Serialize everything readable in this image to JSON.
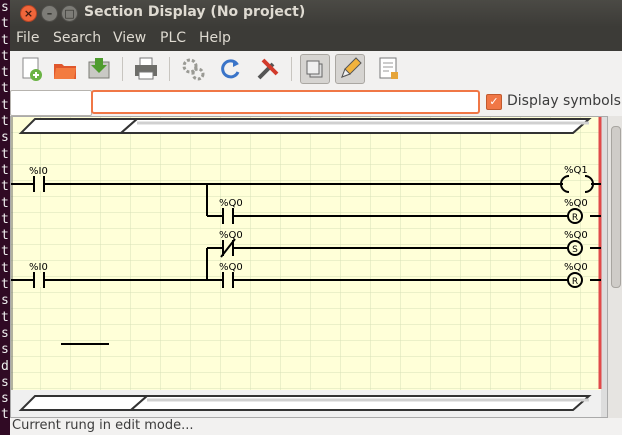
{
  "terminal_chars": [
    "s",
    "t",
    "t",
    "t",
    "t",
    "t",
    "t",
    "t",
    "s",
    "t",
    "t",
    "t",
    "t",
    "t",
    "t",
    "t",
    "t",
    "t",
    "s",
    "t",
    "s",
    "s",
    "d",
    "s",
    "s",
    "t"
  ],
  "window": {
    "title": "Section Display (No project)",
    "close_glyph": "×",
    "min_glyph": "–",
    "max_glyph": "□"
  },
  "menu": [
    "File",
    "Search",
    "View",
    "PLC",
    "Help"
  ],
  "toolbar_icons": [
    "new-file-icon",
    "open-folder-icon",
    "save-download-icon",
    "print-icon",
    "gears-icon",
    "refresh-icon",
    "tools-icon",
    "copy-sections-icon",
    "pencil-edit-icon",
    "properties-icon"
  ],
  "search": {
    "small_value": "",
    "main_value": ""
  },
  "display_symbols": {
    "label": "Display symbols",
    "checked": true,
    "check_glyph": "✓"
  },
  "ladder": {
    "rung1": {
      "input_label": "%I0",
      "coil1_label": "%Q1",
      "branch_contact_label": "%Q0",
      "coil2_label": "%Q0",
      "coil2_type": "R"
    },
    "rung2": {
      "input_label": "%I0",
      "neg_contact_label": "%Q0",
      "branch_contact_label": "%Q0",
      "coil1_label": "%Q0",
      "coil1_type": "S",
      "coil2_label": "%Q0",
      "coil2_type": "R"
    }
  },
  "status": {
    "text": "Current rung in edit mode..."
  },
  "colors": {
    "grid_bg": "#ffffd8",
    "grid_line": "#d7e0b8",
    "accent": "#f07746",
    "rung_border": "#e04a4a"
  }
}
